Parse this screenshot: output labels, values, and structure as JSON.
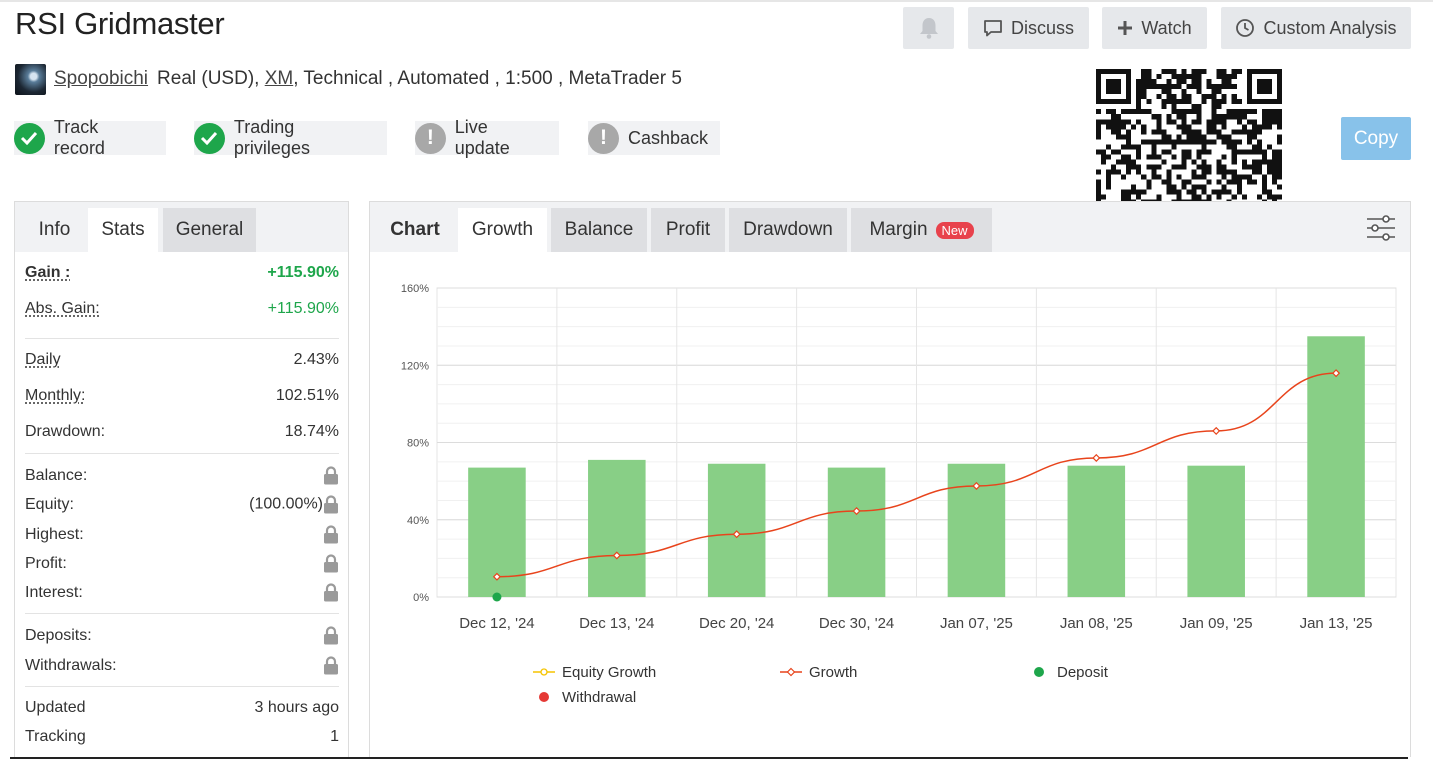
{
  "page": {
    "title": "RSI Gridmaster"
  },
  "header_buttons": {
    "discuss": "Discuss",
    "watch": "Watch",
    "custom_analysis": "Custom Analysis"
  },
  "account": {
    "user": "Spopobichi",
    "type": "Real (USD),",
    "broker": "XM",
    "details": ", Technical , Automated , 1:500 , MetaTrader 5"
  },
  "badges": [
    {
      "label": "Track record",
      "status": "ok"
    },
    {
      "label": "Trading privileges",
      "status": "ok"
    },
    {
      "label": "Live update",
      "status": "warn"
    },
    {
      "label": "Cashback",
      "status": "warn"
    }
  ],
  "copy_button": "Copy",
  "left_tabs": [
    "Info",
    "Stats",
    "General"
  ],
  "stats": {
    "gain": {
      "label": "Gain :",
      "value": "+115.90%"
    },
    "abs_gain": {
      "label": "Abs. Gain:",
      "value": "+115.90%"
    },
    "daily": {
      "label": "Daily",
      "value": "2.43%"
    },
    "monthly": {
      "label": "Monthly:",
      "value": "102.51%"
    },
    "drawdown": {
      "label": "Drawdown:",
      "value": "18.74%"
    },
    "balance": {
      "label": "Balance:"
    },
    "equity": {
      "label": "Equity:",
      "value": "(100.00%)"
    },
    "highest": {
      "label": "Highest:"
    },
    "profit": {
      "label": "Profit:"
    },
    "interest": {
      "label": "Interest:"
    },
    "deposits": {
      "label": "Deposits:"
    },
    "withdrawals": {
      "label": "Withdrawals:"
    },
    "updated": {
      "label": "Updated",
      "value": "3 hours ago"
    },
    "tracking": {
      "label": "Tracking",
      "value": "1"
    }
  },
  "right_tabs": {
    "label": "Chart",
    "tabs": [
      "Growth",
      "Balance",
      "Profit",
      "Drawdown",
      "Margin"
    ],
    "new_badge": "New"
  },
  "colors": {
    "bar": "#88cf86",
    "growth_line": "#e8441c",
    "equity_growth": "#f5c400",
    "deposit": "#1ea64b",
    "withdrawal": "#e53935",
    "green_text": "#1ea64b"
  },
  "chart_data": {
    "type": "bar",
    "categories": [
      "Dec 12, '24",
      "Dec 13, '24",
      "Dec 20, '24",
      "Dec 30, '24",
      "Jan 07, '25",
      "Jan 08, '25",
      "Jan 09, '25",
      "Jan 13, '25"
    ],
    "series": [
      {
        "name": "Equity Growth",
        "type": "bar",
        "values": [
          67,
          71,
          69,
          67,
          69,
          68,
          68,
          135
        ]
      },
      {
        "name": "Growth",
        "type": "line",
        "values": [
          10.5,
          21.5,
          32.5,
          44.5,
          57.5,
          72,
          86,
          115.9
        ]
      },
      {
        "name": "Deposit",
        "type": "scatter",
        "values": [
          0,
          null,
          null,
          null,
          null,
          null,
          null,
          null
        ]
      },
      {
        "name": "Withdrawal",
        "type": "scatter",
        "values": []
      }
    ],
    "ylim": [
      0,
      160
    ],
    "yticks": [
      0,
      40,
      80,
      120,
      160
    ],
    "ytick_labels": [
      "0%",
      "40%",
      "80%",
      "120%",
      "160%"
    ],
    "grid": true,
    "legend_position": "bottom"
  }
}
